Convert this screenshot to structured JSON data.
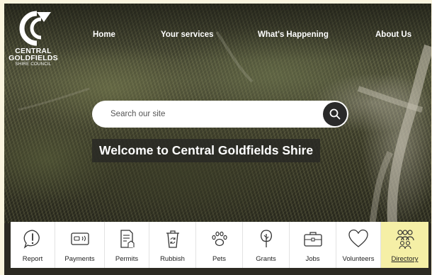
{
  "logo": {
    "line1": "CENTRAL",
    "line2": "GOLDFIELDS",
    "line3": "SHIRE COUNCIL"
  },
  "nav": {
    "items": [
      {
        "label": "Home"
      },
      {
        "label": "Your services"
      },
      {
        "label": "What's Happening"
      },
      {
        "label": "About Us"
      }
    ]
  },
  "search": {
    "placeholder": "Search our site",
    "icon": "search-icon"
  },
  "hero": {
    "heading": "Welcome to Central Goldfields Shire"
  },
  "quicklinks": {
    "items": [
      {
        "label": "Report",
        "icon": "alert-icon"
      },
      {
        "label": "Payments",
        "icon": "card-payment-icon"
      },
      {
        "label": "Permits",
        "icon": "permit-document-icon"
      },
      {
        "label": "Rubbish",
        "icon": "recycle-bin-icon"
      },
      {
        "label": "Pets",
        "icon": "paw-icon"
      },
      {
        "label": "Grants",
        "icon": "tree-icon"
      },
      {
        "label": "Jobs",
        "icon": "briefcase-icon"
      },
      {
        "label": "Volunteers",
        "icon": "heart-icon"
      },
      {
        "label": "Directory",
        "icon": "people-group-icon",
        "active": true
      }
    ]
  },
  "colors": {
    "page_background": "#fbf5df",
    "active_tile": "#f5efa6",
    "search_button": "#2a2a2a",
    "text_white": "#ffffff"
  }
}
